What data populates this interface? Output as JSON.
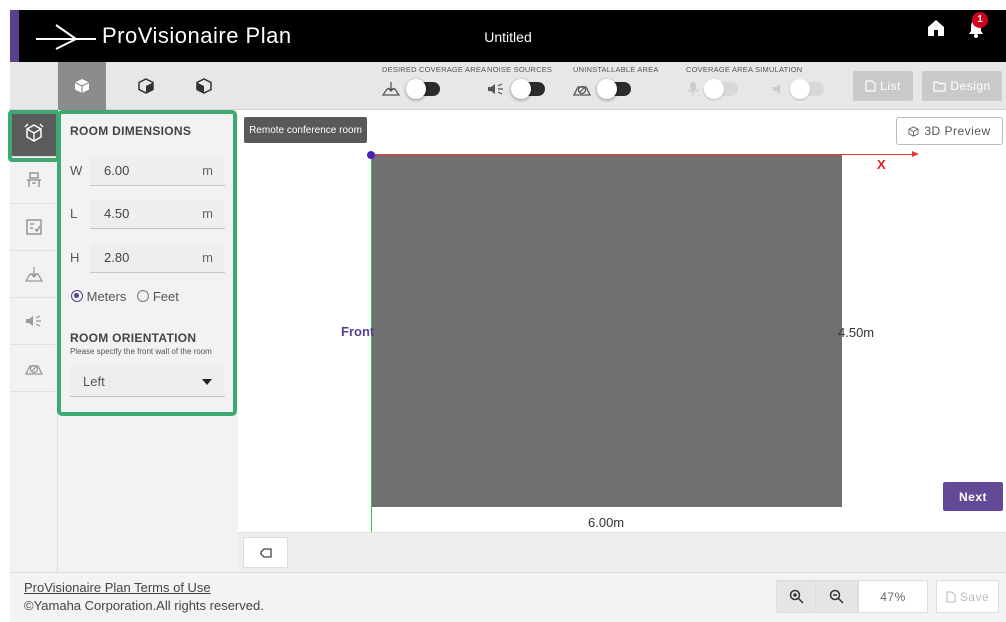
{
  "header": {
    "app_title": "ProVisionaire Plan",
    "document_title": "Untitled",
    "notification_count": "1"
  },
  "toolbar": {
    "views": [
      {
        "icon": "cube-front-icon",
        "active": true
      },
      {
        "icon": "cube-iso-icon",
        "active": false
      },
      {
        "icon": "cube-side-icon",
        "active": false
      }
    ],
    "toggles": [
      {
        "label": "DESIRED COVERAGE AREA",
        "icon": "coverage-area-icon",
        "on": false,
        "enabled": true
      },
      {
        "label": "NOISE SOURCES",
        "icon": "noise-speaker-icon",
        "on": false,
        "enabled": true
      },
      {
        "label": "UNINSTALLABLE AREA",
        "icon": "uninstallable-area-icon",
        "on": false,
        "enabled": true
      }
    ],
    "simulation": {
      "label": "COVERAGE AREA SIMULATION",
      "toggles": [
        {
          "icon": "microphone-icon",
          "on": false,
          "enabled": false
        },
        {
          "icon": "speaker-icon",
          "on": false,
          "enabled": false
        }
      ]
    },
    "list_label": "List",
    "design_label": "Design"
  },
  "rail": {
    "items": [
      {
        "icon": "room-cube-icon",
        "active": true
      },
      {
        "icon": "table-furniture-icon",
        "active": false
      },
      {
        "icon": "checklist-icon",
        "active": false
      },
      {
        "icon": "coverage-area-icon",
        "active": false
      },
      {
        "icon": "noise-speaker-icon",
        "active": false
      },
      {
        "icon": "uninstallable-area-icon",
        "active": false
      }
    ]
  },
  "panel": {
    "heading": "ROOM DIMENSIONS",
    "dimensions": [
      {
        "letter": "W",
        "value": "6.00",
        "unit": "m"
      },
      {
        "letter": "L",
        "value": "4.50",
        "unit": "m"
      },
      {
        "letter": "H",
        "value": "2.80",
        "unit": "m"
      }
    ],
    "units": {
      "meters": "Meters",
      "feet": "Feet",
      "selected": "meters"
    },
    "orientation": {
      "heading": "ROOM ORIENTATION",
      "note": "Please specify the front wall of the room",
      "selected": "Left"
    }
  },
  "canvas": {
    "room_name": "Remote conference room",
    "preview_label": "3D Preview",
    "x_axis_label": "X",
    "front_label": "Front",
    "length_label": "4.50m",
    "width_label": "6.00m",
    "next_label": "Next"
  },
  "footer": {
    "terms": "ProVisionaire Plan Terms of Use",
    "copyright": "©Yamaha Corporation.All rights reserved.",
    "zoom": "47%",
    "save_label": "Save"
  }
}
